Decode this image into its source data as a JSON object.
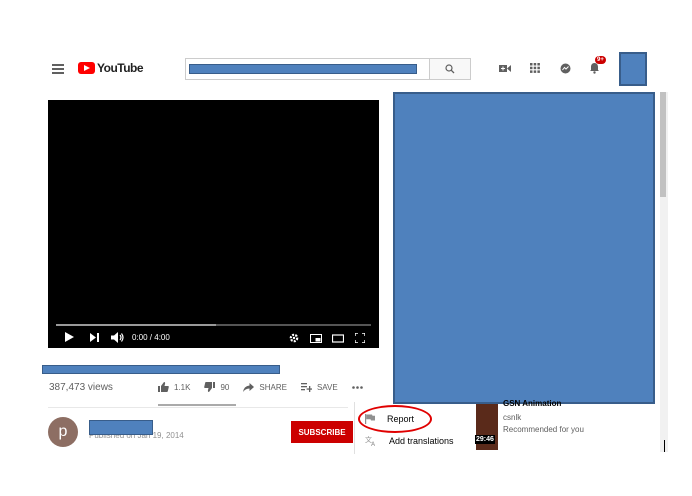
{
  "header": {
    "logo_text": "YouTube",
    "notification_badge": "9+"
  },
  "player": {
    "time": "0:00 / 4:00",
    "progress_fraction": 0.0
  },
  "video": {
    "views": "387,473 views",
    "likes": "1.1K",
    "dislikes": "90",
    "share_label": "SHARE",
    "save_label": "SAVE"
  },
  "channel": {
    "avatar_letter": "p",
    "published": "Published on Jan 19, 2014",
    "subscribe_label": "SUBSCRIBE"
  },
  "menu": {
    "items": [
      {
        "label": "Report",
        "icon": "flag-icon"
      },
      {
        "label": "Add translations",
        "icon": "translate-icon"
      }
    ]
  },
  "recommended": {
    "title": "GSN Animation",
    "channel": "csnlk",
    "reason": "Recommended for you",
    "duration": "29:46"
  },
  "colors": {
    "brand_red": "#ff0000",
    "subscribe_red": "#cc0000",
    "redaction_blue": "#4f81bd",
    "annotation_red": "#e00000"
  }
}
